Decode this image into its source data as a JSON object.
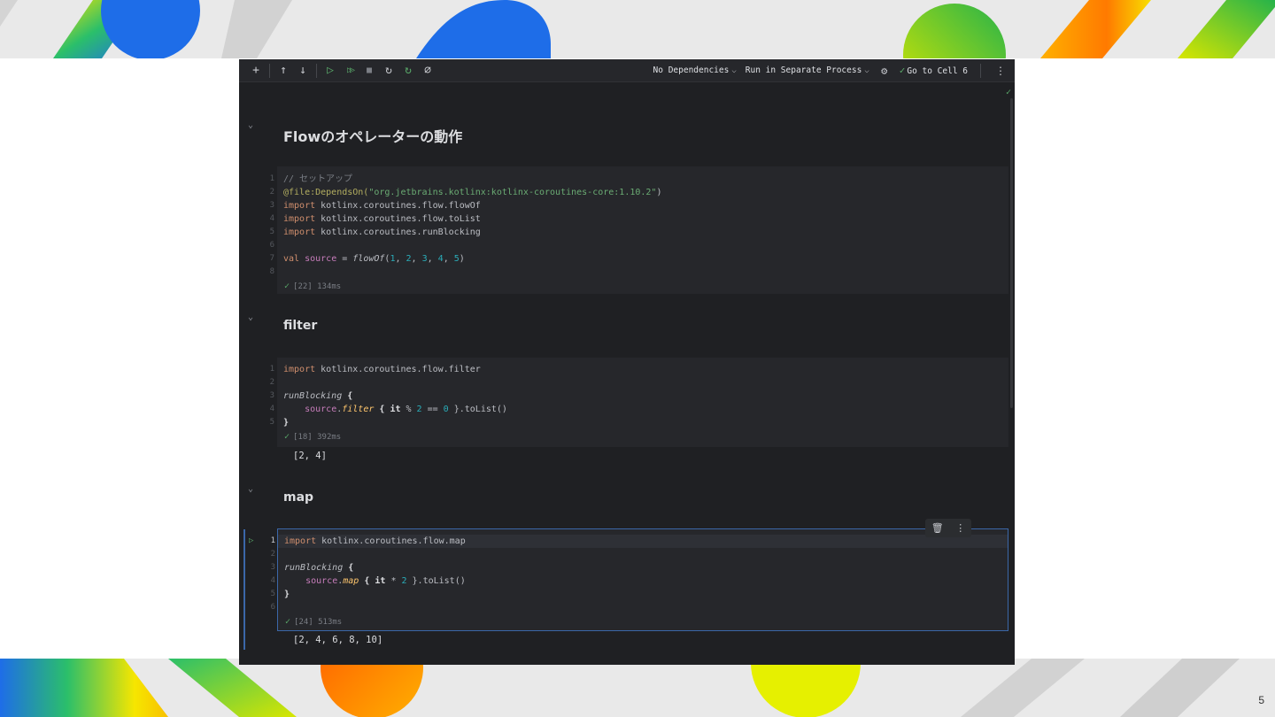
{
  "slide": {
    "number": "5"
  },
  "toolbar": {
    "add_icon": "+",
    "move_up_icon": "↑",
    "move_down_icon": "↓",
    "run_cell_icon": "▷",
    "run_all_icon": "▷▷",
    "stop_icon": "■",
    "restart_icon": "↻",
    "restart_run_icon": "↻",
    "clear_icon": "⌀",
    "dependencies_label": "No Dependencies",
    "process_label": "Run in Separate Process",
    "settings_icon": "⚙",
    "goto_check_icon": "✓",
    "goto_label": "Go to Cell 6",
    "more_icon": "⋮"
  },
  "notebook": {
    "fold_icon": "⌄",
    "ok_icon": "✓",
    "headings": [
      "Flowのオペレーターの動作",
      "filter",
      "map"
    ],
    "cell1": {
      "line_numbers": [
        "1",
        "2",
        "3",
        "4",
        "5",
        "6",
        "7",
        "8"
      ],
      "comment": "// セットアップ",
      "annotation": "@file:DependsOn(",
      "dep_string": "\"org.jetbrains.kotlinx:kotlinx-coroutines-core:1.10.2\"",
      "close_paren": ")",
      "import_kw": "import",
      "imports": [
        "kotlinx.coroutines.flow.flowOf",
        "kotlinx.coroutines.flow.toList",
        "kotlinx.coroutines.runBlocking"
      ],
      "val_kw": "val",
      "var_name": "source",
      "assign": " = ",
      "func": "flowOf",
      "paren_open": "(",
      "args": [
        "1",
        "2",
        "3",
        "4",
        "5"
      ],
      "sep": ", ",
      "paren_close": ")",
      "status": "[22] 134ms"
    },
    "cell2": {
      "line_numbers": [
        "1",
        "2",
        "3",
        "4",
        "5"
      ],
      "import_kw": "import",
      "import": "kotlinx.coroutines.flow.filter",
      "run_blocking": "runBlocking",
      "brace_open": " {",
      "indent": "    ",
      "source": "source",
      "dot": ".",
      "op": "filter",
      "lambda_open": " { ",
      "it": "it",
      "expr_op1": " % ",
      "num1": "2",
      "expr_op2": " == ",
      "num2": "0",
      "lambda_close": " }.toList()",
      "brace_close": "}",
      "status": "[18] 392ms",
      "output": "[2, 4]"
    },
    "cell3": {
      "run_icon": "▷",
      "line_numbers": [
        "1",
        "2",
        "3",
        "4",
        "5",
        "6"
      ],
      "import_kw": "import",
      "import": "kotlinx.coroutines.flow.map",
      "run_blocking": "runBlocking",
      "brace_open": " {",
      "indent": "    ",
      "source": "source",
      "dot": ".",
      "op": "map",
      "lambda_open": " { ",
      "it": "it",
      "expr_op1": " * ",
      "num1": "2",
      "lambda_close": " }.toList()",
      "brace_close": "}",
      "status": "[24] 513ms",
      "output": "[2, 4, 6, 8, 10]",
      "delete_icon": "🗑",
      "more_icon": "⋮"
    }
  }
}
